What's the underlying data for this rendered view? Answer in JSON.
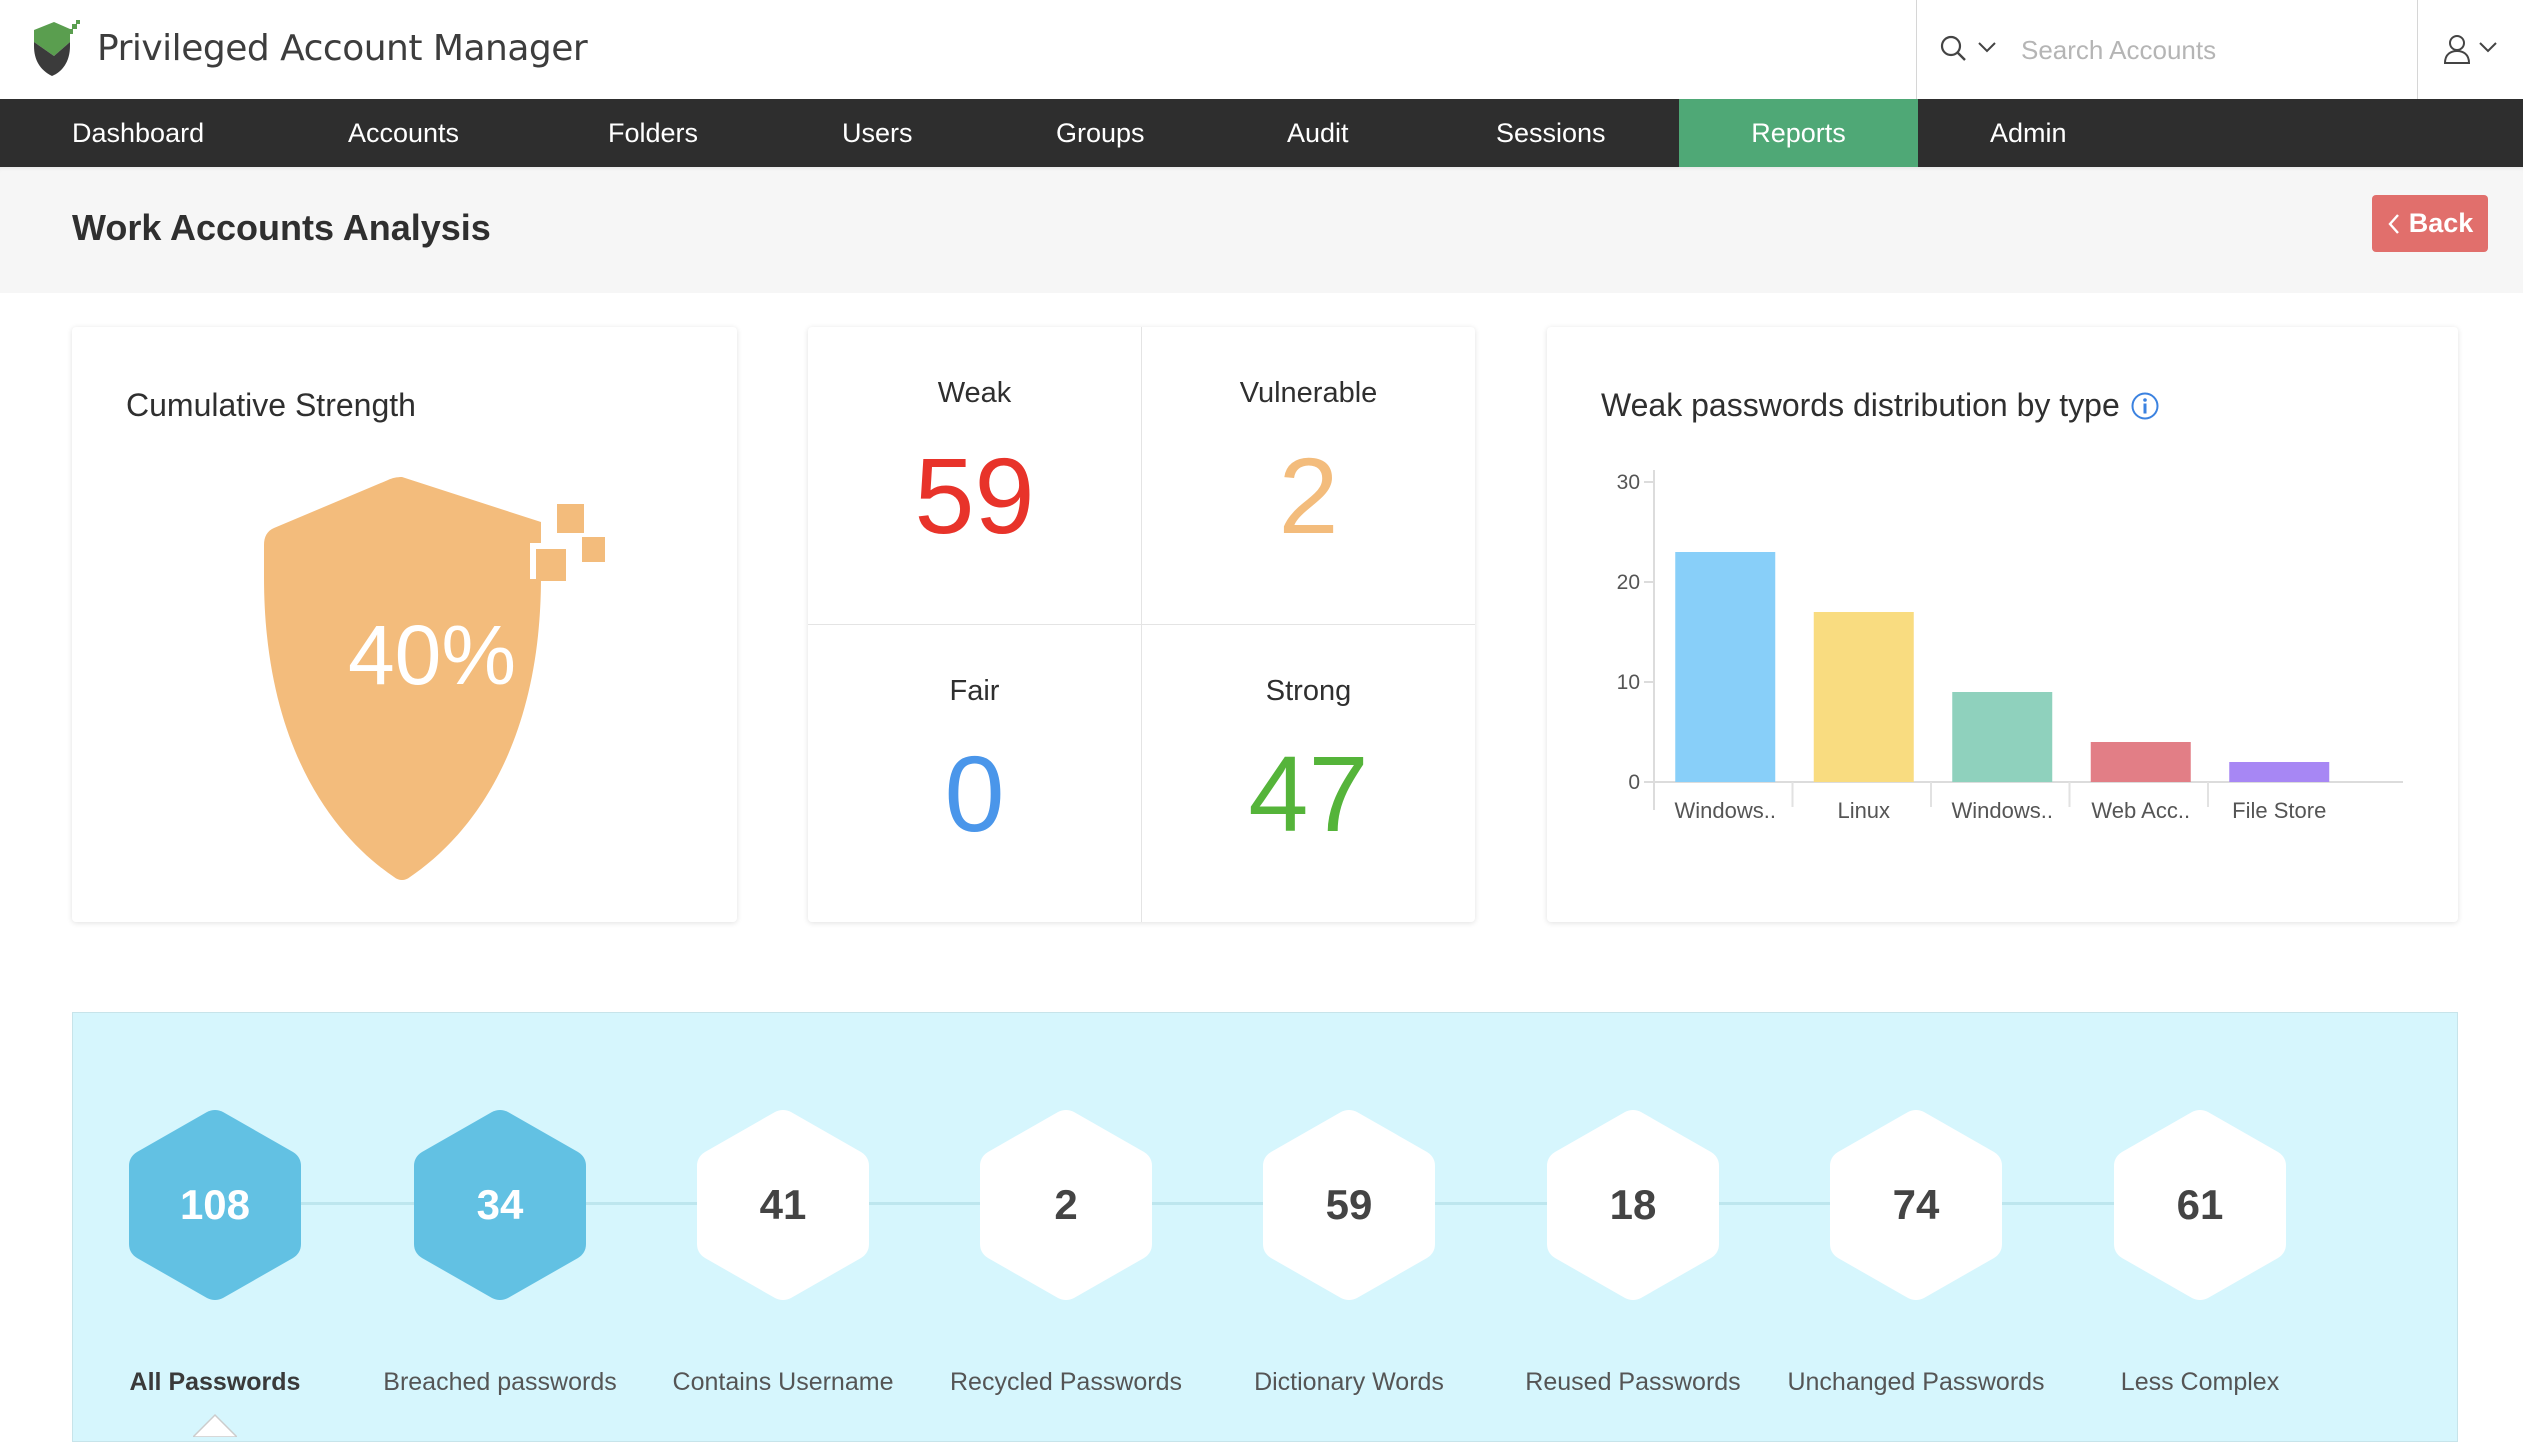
{
  "app": {
    "title": "Privileged Account Manager",
    "logo_icon": "shield-check-logo"
  },
  "search": {
    "placeholder": "Search Accounts",
    "value": "",
    "icon": "search-icon",
    "dropdown_icon": "chevron-down-icon"
  },
  "user_menu": {
    "icon": "user-icon",
    "dropdown_icon": "chevron-down-icon"
  },
  "nav": {
    "items": [
      {
        "label": "Dashboard",
        "active": false
      },
      {
        "label": "Accounts",
        "active": false
      },
      {
        "label": "Folders",
        "active": false
      },
      {
        "label": "Users",
        "active": false
      },
      {
        "label": "Groups",
        "active": false
      },
      {
        "label": "Audit",
        "active": false
      },
      {
        "label": "Sessions",
        "active": false
      },
      {
        "label": "Reports",
        "active": true
      },
      {
        "label": "Admin",
        "active": false
      }
    ],
    "active_color": "#4fa876"
  },
  "page": {
    "title": "Work Accounts Analysis",
    "back_label": "Back",
    "back_icon": "chevron-left-icon"
  },
  "cumulative_strength": {
    "title": "Cumulative Strength",
    "value_label": "40%",
    "percent": 40,
    "color": "#f3bc7c"
  },
  "strength_stats": [
    {
      "label": "Weak",
      "value": "59",
      "color": "#e8332a"
    },
    {
      "label": "Vulnerable",
      "value": "2",
      "color": "#f3bc7c"
    },
    {
      "label": "Fair",
      "value": "0",
      "color": "#4a96ea"
    },
    {
      "label": "Strong",
      "value": "47",
      "color": "#55b43a"
    }
  ],
  "chart_data": {
    "type": "bar",
    "title": "Weak passwords distribution by type",
    "info_icon": "info-icon",
    "categories": [
      "Windows..",
      "Linux",
      "Windows..",
      "Web Acc..",
      "File Store"
    ],
    "values": [
      23,
      17,
      9,
      4,
      2
    ],
    "colors": [
      "#88cff9",
      "#f9dc80",
      "#8fd1bd",
      "#e27e86",
      "#a787f4"
    ],
    "xlabel": "",
    "ylabel": "",
    "ylim": [
      0,
      30
    ],
    "yticks": [
      0,
      10,
      20,
      30
    ],
    "grid": false,
    "legend": "none"
  },
  "password_issues": {
    "active_index": 0,
    "active_color": "#62c1e3",
    "items": [
      {
        "label": "All Passwords",
        "value": "108",
        "highlighted": true
      },
      {
        "label": "Breached passwords",
        "value": "34",
        "highlighted": true
      },
      {
        "label": "Contains Username",
        "value": "41",
        "highlighted": false
      },
      {
        "label": "Recycled Passwords",
        "value": "2",
        "highlighted": false
      },
      {
        "label": "Dictionary Words",
        "value": "59",
        "highlighted": false
      },
      {
        "label": "Reused Passwords",
        "value": "18",
        "highlighted": false
      },
      {
        "label": "Unchanged Passwords",
        "value": "74",
        "highlighted": false
      },
      {
        "label": "Less Complex",
        "value": "61",
        "highlighted": false
      }
    ]
  }
}
